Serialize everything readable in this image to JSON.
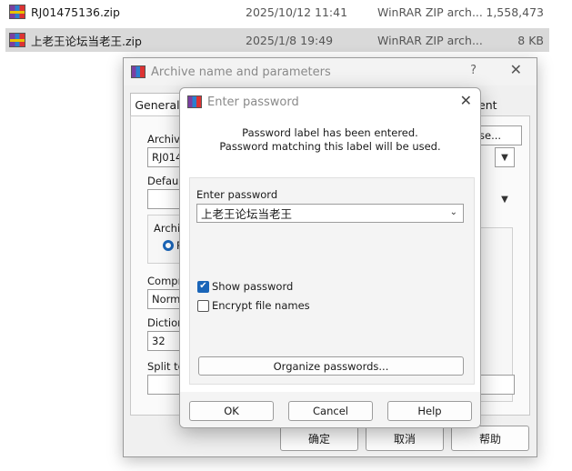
{
  "file_list": {
    "rows": [
      {
        "name": "RJ01475136.zip",
        "date": "2025/10/12 11:41",
        "type": "WinRAR ZIP arch...",
        "size": "1,558,473"
      },
      {
        "name": "上老王论坛当老王.zip",
        "date": "2025/1/8 19:49",
        "type": "WinRAR ZIP arch...",
        "size": "8 KB"
      }
    ]
  },
  "archive_dialog": {
    "title": "Archive name and parameters",
    "help_label": "?",
    "close_label": "✕",
    "tab_general": "General",
    "tab_comment": "ent",
    "archive_name_label": "Archive",
    "archive_name_value": "RJ014",
    "browse_label": "se...",
    "default_profile_label": "Default",
    "archive_format_label": "Archiv",
    "radio_label": "R",
    "compression_label": "Compre",
    "compression_value": "Normal",
    "dictionary_label": "Dictiona",
    "dictionary_value": "32",
    "split_label": "Split to",
    "ok_label": "确定",
    "cancel_label": "取消",
    "help_button_label": "帮助"
  },
  "password_dialog": {
    "title": "Enter password",
    "close_label": "✕",
    "info_line1": "Password label has been entered.",
    "info_line2": "Password matching this label will be used.",
    "field_label": "Enter password",
    "field_value": "上老王论坛当老王",
    "show_password_label": "Show password",
    "show_password_checked": true,
    "encrypt_names_label": "Encrypt file names",
    "encrypt_names_checked": false,
    "organize_label": "Organize passwords...",
    "ok_label": "OK",
    "cancel_label": "Cancel",
    "help_label": "Help"
  },
  "colors": {
    "accent": "#1a65b8",
    "selected_row": "#d9d9d9",
    "dialog_bg": "#f0f0f0"
  }
}
